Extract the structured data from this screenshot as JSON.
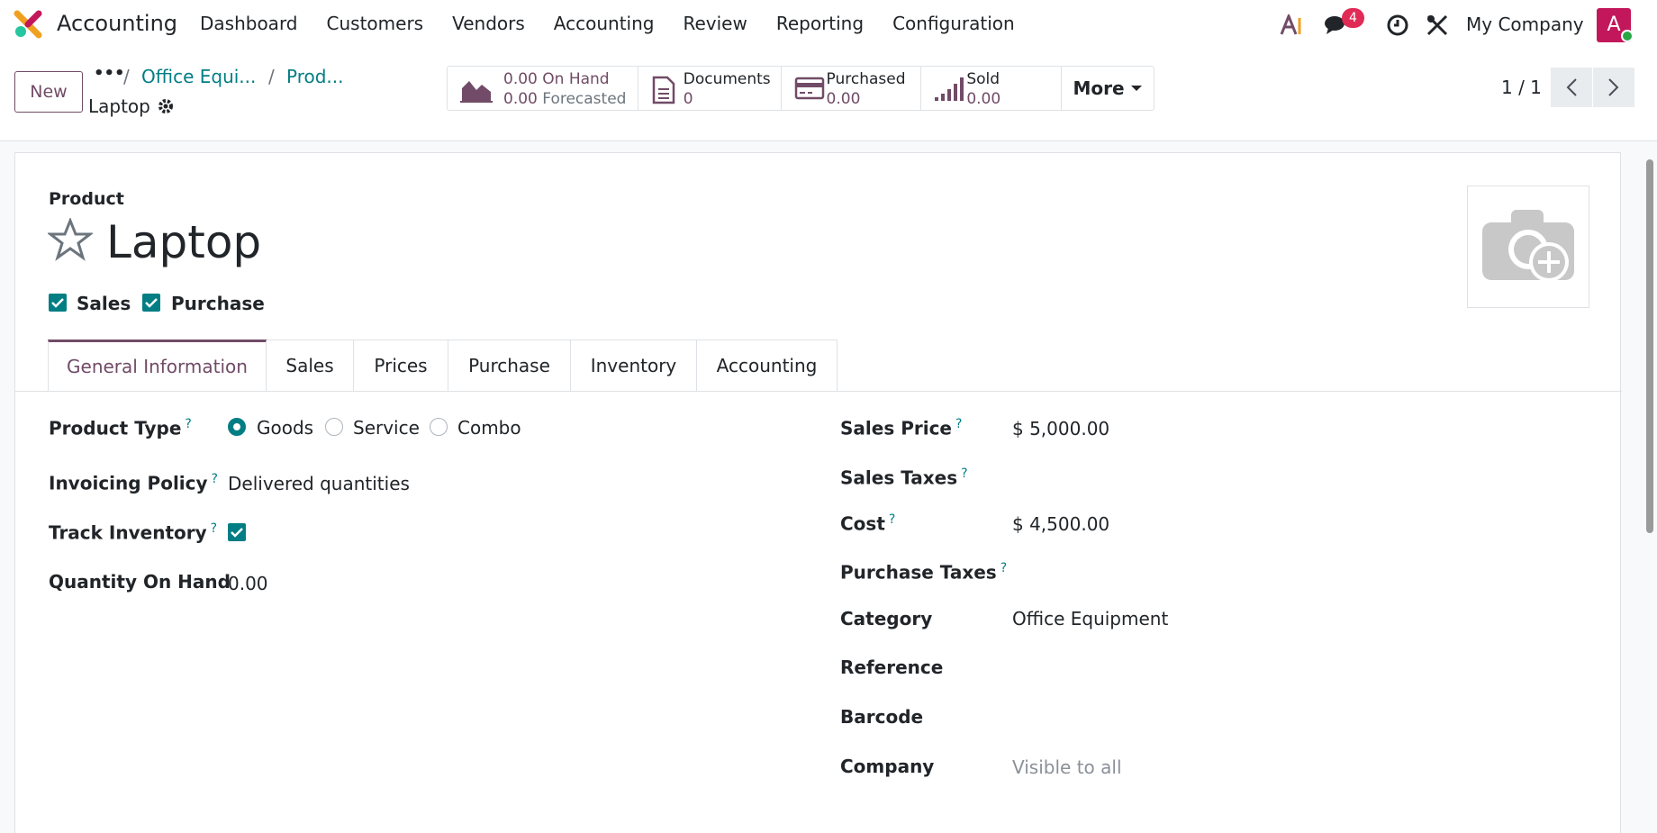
{
  "app": {
    "name": "Accounting"
  },
  "menu": [
    "Dashboard",
    "Customers",
    "Vendors",
    "Accounting",
    "Review",
    "Reporting",
    "Configuration"
  ],
  "nav": {
    "chat_count": "4",
    "company": "My Company",
    "avatar_letter": "A"
  },
  "control": {
    "new_label": "New",
    "breadcrumb_dots": "•••",
    "breadcrumb": [
      "Office Equi...",
      "Prod..."
    ],
    "current": "Laptop",
    "stats": {
      "onhand_value": "0.00",
      "onhand_label": "On Hand",
      "forecast_value": "0.00",
      "forecast_label": "Forecasted",
      "documents_label": "Documents",
      "documents_value": "0",
      "purchased_label": "Purchased",
      "purchased_value": "0.00",
      "sold_label": "Sold",
      "sold_value": "0.00",
      "more_label": "More"
    },
    "pager": "1 / 1"
  },
  "form": {
    "product_label": "Product",
    "name": "Laptop",
    "sales_cb": "Sales",
    "purchase_cb": "Purchase",
    "tabs": [
      "General Information",
      "Sales",
      "Prices",
      "Purchase",
      "Inventory",
      "Accounting"
    ],
    "left": {
      "product_type": "Product Type",
      "types": [
        "Goods",
        "Service",
        "Combo"
      ],
      "invoicing_policy": "Invoicing Policy",
      "invoicing_value": "Delivered quantities",
      "track_inventory": "Track Inventory",
      "qty_on_hand": "Quantity On Hand",
      "qty_value": "0.00"
    },
    "right": {
      "sales_price": "Sales Price",
      "sales_price_value": "$ 5,000.00",
      "sales_taxes": "Sales Taxes",
      "cost": "Cost",
      "cost_value": "$ 4,500.00",
      "purchase_taxes": "Purchase Taxes",
      "category": "Category",
      "category_value": "Office Equipment",
      "reference": "Reference",
      "barcode": "Barcode",
      "company": "Company",
      "company_placeholder": "Visible to all"
    },
    "help_mark": "?"
  },
  "colors": {
    "brand": "#714b67",
    "teal": "#017e84",
    "badge": "#e02b56"
  }
}
